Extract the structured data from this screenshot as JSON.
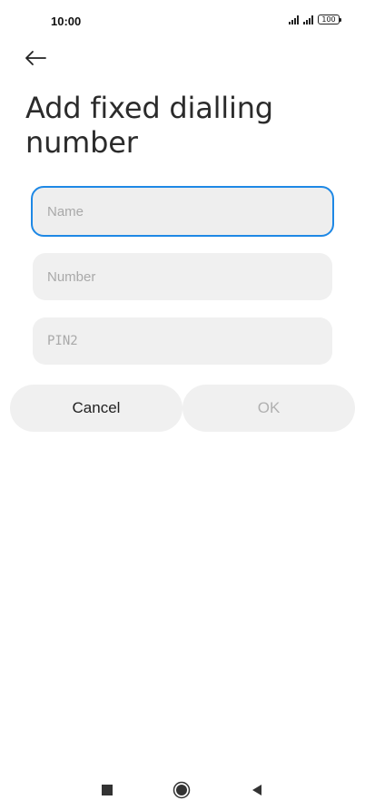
{
  "status_bar": {
    "time": "10:00",
    "battery": "100",
    "icons": [
      "signal-icon",
      "signal-icon",
      "battery-icon"
    ]
  },
  "header": {
    "back_icon": "arrow-left-icon",
    "title": "Add fixed dialling number"
  },
  "form": {
    "name": {
      "placeholder": "Name",
      "value": ""
    },
    "number": {
      "placeholder": "Number",
      "value": ""
    },
    "pin2": {
      "placeholder": "PIN2",
      "value": ""
    }
  },
  "actions": {
    "cancel_label": "Cancel",
    "ok_label": "OK"
  },
  "colors": {
    "focus_border": "#1e88e5",
    "field_bg": "#f0f0f0",
    "disabled_text": "#b0b0b0"
  },
  "nav_bar": {
    "icons": [
      "recents-square-icon",
      "home-circle-icon",
      "back-triangle-icon"
    ]
  }
}
